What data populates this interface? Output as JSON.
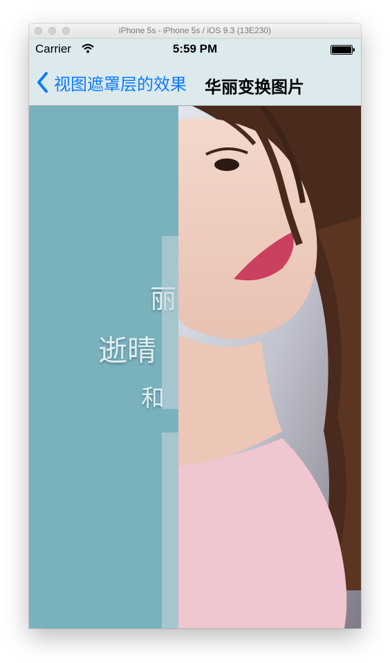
{
  "window": {
    "title": "iPhone 5s - iPhone 5s / iOS 9.3 (13E230)"
  },
  "status_bar": {
    "carrier": "Carrier",
    "time": "5:59 PM",
    "icons": [
      "wifi-icon",
      "battery-icon"
    ]
  },
  "nav_bar": {
    "back_label": "视图遮罩层的效果",
    "title": "华丽变换图片",
    "back_icon": "chevron-left-icon",
    "tint_color": "#0a7aff"
  },
  "content": {
    "handwriting_lines": [
      "丽",
      "逝晴",
      "和"
    ],
    "left_panel_color": "#79b1bd"
  }
}
